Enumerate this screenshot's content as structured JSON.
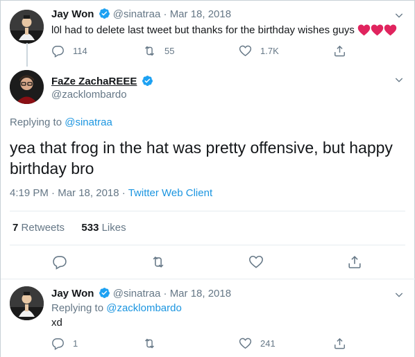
{
  "tweet1": {
    "name": "Jay Won",
    "handle": "@sinatraa",
    "sep": "·",
    "date": "Mar 18, 2018",
    "text": "l0l had to delete last tweet but thanks for the birthday wishes guys",
    "emoji": "heart-emoji x3",
    "replies": "114",
    "retweets": "55",
    "likes": "1.7K"
  },
  "main": {
    "name": "FaZe ZachaREEE",
    "handle": "@zacklombardo",
    "replying_prefix": "Replying to",
    "replying_to": "@sinatraa",
    "text_line1": "yea that frog in the hat was pretty offensive, but happy",
    "text_line2": "birthday bro",
    "time": "4:19 PM",
    "sep": "·",
    "date": "Mar 18, 2018",
    "client": "Twitter Web Client",
    "retweets_count": "7",
    "retweets_label": "Retweets",
    "likes_count": "533",
    "likes_label": "Likes"
  },
  "tweet3": {
    "name": "Jay Won",
    "handle": "@sinatraa",
    "sep": "·",
    "date": "Mar 18, 2018",
    "replying_prefix": "Replying to",
    "replying_to": "@zacklombardo",
    "text": "xd",
    "replies": "1",
    "retweets": "",
    "likes": "241"
  },
  "colors": {
    "verified": "#1da1f2",
    "link": "#1b95e0",
    "heart": "#e0245e",
    "muted": "#657786"
  }
}
